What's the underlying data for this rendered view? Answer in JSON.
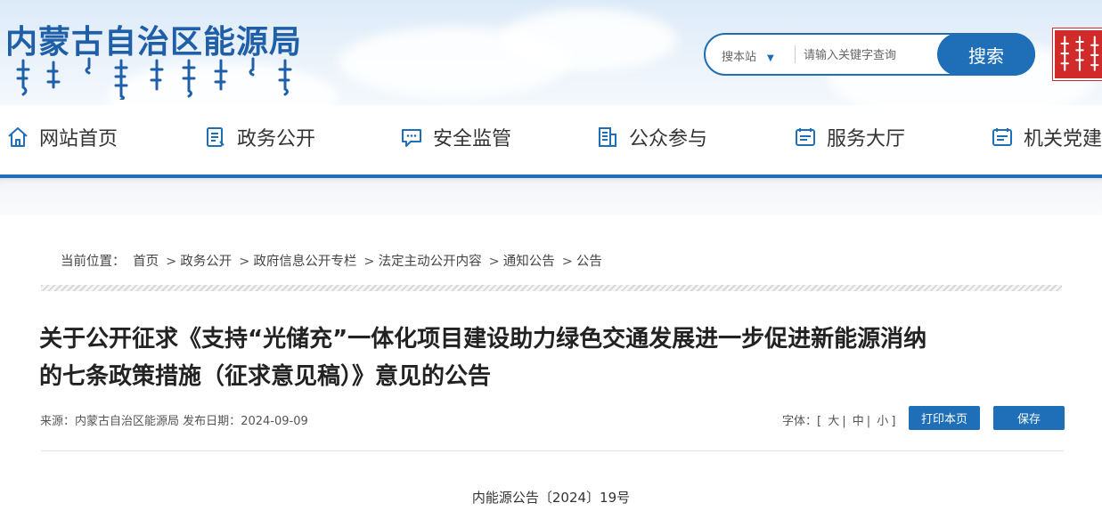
{
  "header": {
    "site_title": "内蒙古自治区能源局",
    "search": {
      "scope_label": "搜本站",
      "placeholder": "请输入关键字查询",
      "button_label": "搜索"
    },
    "accent_color": "#1e6fb8",
    "seal_color": "#d02a2a"
  },
  "nav": {
    "items": [
      {
        "label": "网站首页",
        "icon": "home-icon"
      },
      {
        "label": "政务公开",
        "icon": "document-icon"
      },
      {
        "label": "安全监管",
        "icon": "chat-icon"
      },
      {
        "label": "公众参与",
        "icon": "report-icon"
      },
      {
        "label": "服务大厅",
        "icon": "id-card-icon"
      },
      {
        "label": "机关党建",
        "icon": "id-card-icon"
      }
    ]
  },
  "breadcrumb": {
    "prefix": "当前位置：",
    "items": [
      "首页",
      "政务公开",
      "政府信息公开专栏",
      "法定主动公开内容",
      "通知公告",
      "公告"
    ],
    "separator": ">"
  },
  "article": {
    "title_line1": "关于公开征求《支持“光储充”一体化项目建设助力绿色交通发展进一步促进新能源消纳",
    "title_line2": "的七条政策措施（征求意见稿）》意见的公告",
    "source_label": "来源：",
    "source": "内蒙古自治区能源局",
    "date_label": "发布日期：",
    "date": "2024-09-09",
    "font_label": "字体：",
    "font_sizes": [
      "大",
      "中",
      "小"
    ],
    "print_label": "打印本页",
    "save_label": "保存",
    "doc_number": "内能源公告〔2024〕19号"
  }
}
